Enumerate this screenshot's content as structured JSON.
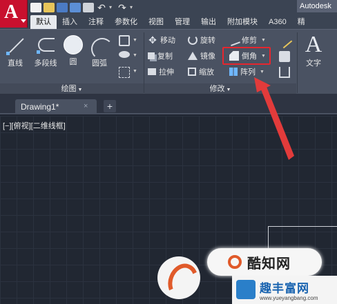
{
  "window": {
    "app_title": "Autodesk"
  },
  "quick_access": {
    "undo_glyph": "↶",
    "redo_glyph": "↷",
    "dropdown_glyph": "▾"
  },
  "ribbon_tabs": [
    {
      "label": "默认",
      "active": true
    },
    {
      "label": "插入"
    },
    {
      "label": "注释"
    },
    {
      "label": "参数化"
    },
    {
      "label": "视图"
    },
    {
      "label": "管理"
    },
    {
      "label": "输出"
    },
    {
      "label": "附加模块"
    },
    {
      "label": "A360"
    },
    {
      "label": "精"
    }
  ],
  "draw_panel": {
    "title": "绘图",
    "tools": {
      "line": "直线",
      "polyline": "多段线",
      "circle": "圆",
      "arc": "圆弧"
    }
  },
  "modify_panel": {
    "title": "修改",
    "tools": {
      "move": "移动",
      "rotate": "旋转",
      "trim": "修剪",
      "copy": "复制",
      "mirror": "镜像",
      "chamfer": "倒角",
      "stretch": "拉伸",
      "scale": "缩放",
      "array": "阵列"
    },
    "move_glyph": "✥"
  },
  "annotation_panel": {
    "text_glyph": "A",
    "text_label": "文字"
  },
  "document": {
    "tab_name": "Drawing1*",
    "close_glyph": "×",
    "new_tab_glyph": "+"
  },
  "viewport": {
    "label": "[−][俯视][二维线框]"
  },
  "watermark": {
    "badge_text": "酷知网",
    "site_name": "趣丰富网",
    "site_url": "www.yueyangbang.com"
  },
  "colors": {
    "highlight": "#e6262e",
    "app_button": "#c8102e",
    "arrow": "#e23b3b"
  }
}
